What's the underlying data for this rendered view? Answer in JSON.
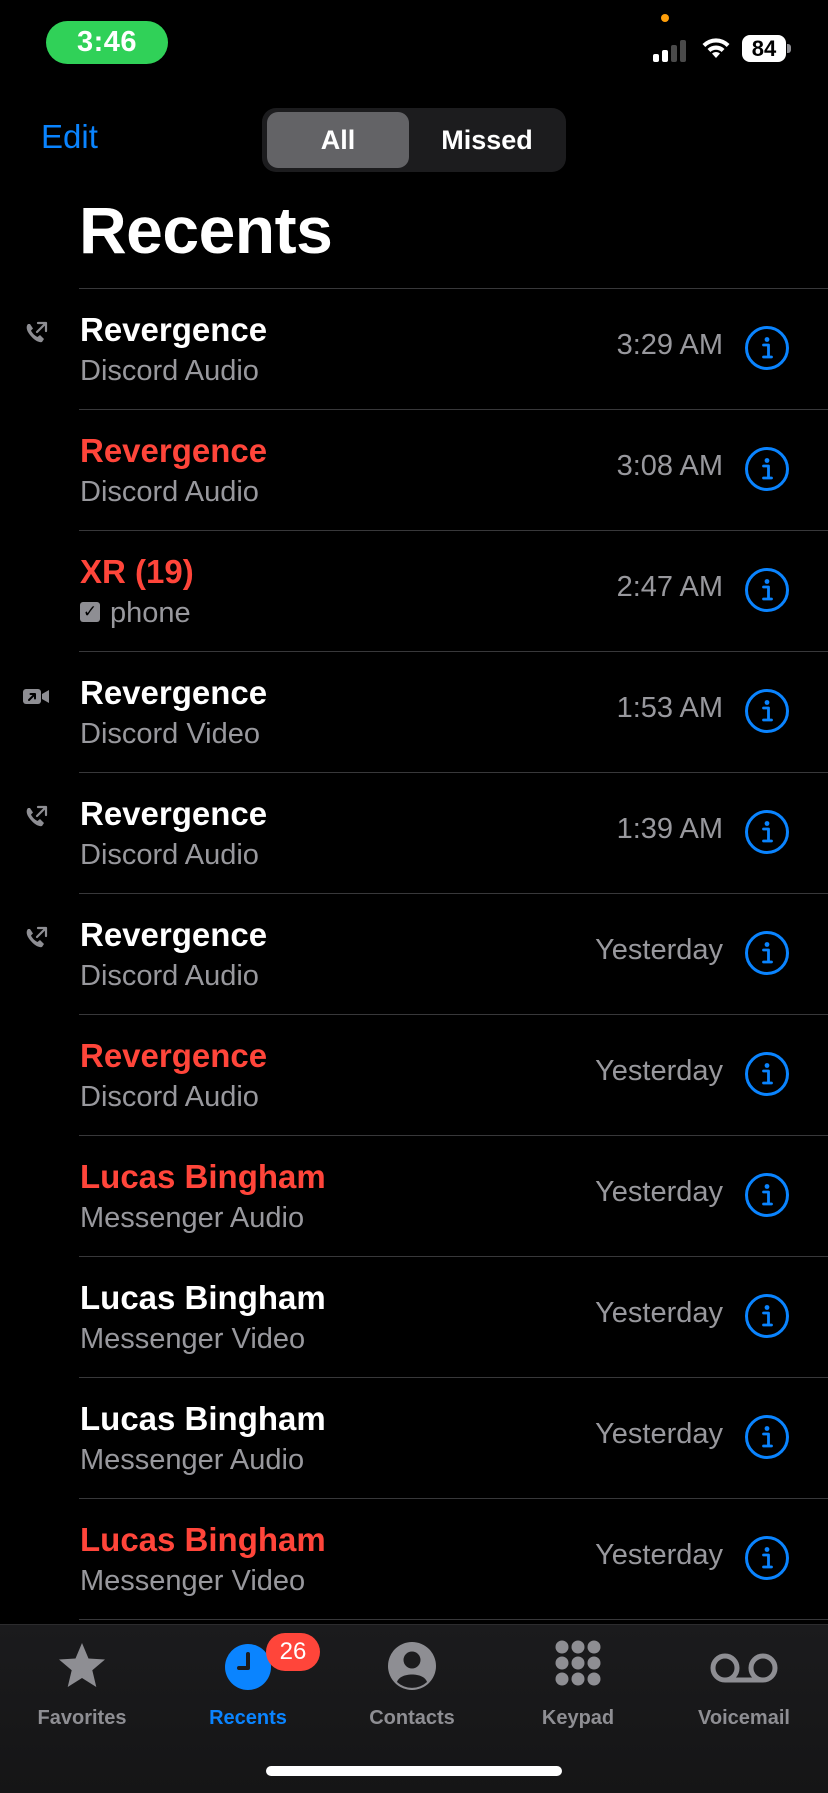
{
  "status_bar": {
    "time": "3:46",
    "battery": "84"
  },
  "nav": {
    "edit_label": "Edit",
    "segments": [
      "All",
      "Missed"
    ],
    "selected_segment": "All"
  },
  "page": {
    "title": "Recents"
  },
  "calls": [
    {
      "name": "Revergence",
      "detail": "Discord Audio",
      "time": "3:29 AM",
      "missed": false,
      "type_icon": "outgoing-call-icon"
    },
    {
      "name": "Revergence",
      "detail": "Discord Audio",
      "time": "3:08 AM",
      "missed": true,
      "type_icon": ""
    },
    {
      "name": "XR (19)",
      "detail": "phone",
      "time": "2:47 AM",
      "missed": true,
      "type_icon": "",
      "detail_icon": "checkbox-icon"
    },
    {
      "name": "Revergence",
      "detail": "Discord Video",
      "time": "1:53 AM",
      "missed": false,
      "type_icon": "outgoing-video-icon"
    },
    {
      "name": "Revergence",
      "detail": "Discord Audio",
      "time": "1:39 AM",
      "missed": false,
      "type_icon": "outgoing-call-icon"
    },
    {
      "name": "Revergence",
      "detail": "Discord Audio",
      "time": "Yesterday",
      "missed": false,
      "type_icon": "outgoing-call-icon"
    },
    {
      "name": "Revergence",
      "detail": "Discord Audio",
      "time": "Yesterday",
      "missed": true,
      "type_icon": ""
    },
    {
      "name": "Lucas Bingham",
      "detail": "Messenger Audio",
      "time": "Yesterday",
      "missed": true,
      "type_icon": ""
    },
    {
      "name": "Lucas Bingham",
      "detail": "Messenger Video",
      "time": "Yesterday",
      "missed": false,
      "type_icon": ""
    },
    {
      "name": "Lucas Bingham",
      "detail": "Messenger Audio",
      "time": "Yesterday",
      "missed": false,
      "type_icon": ""
    },
    {
      "name": "Lucas Bingham",
      "detail": "Messenger Video",
      "time": "Yesterday",
      "missed": true,
      "type_icon": ""
    }
  ],
  "tab_bar": {
    "tabs": [
      {
        "label": "Favorites",
        "icon": "star-icon",
        "active": false
      },
      {
        "label": "Recents",
        "icon": "clock-icon",
        "active": true,
        "badge": "26"
      },
      {
        "label": "Contacts",
        "icon": "person-circle-icon",
        "active": false
      },
      {
        "label": "Keypad",
        "icon": "keypad-icon",
        "active": false
      },
      {
        "label": "Voicemail",
        "icon": "voicemail-icon",
        "active": false
      }
    ]
  },
  "colors": {
    "accent": "#0a84ff",
    "missed": "#ff453a",
    "secondary_text": "#98989d",
    "call_pill": "#30d158"
  }
}
